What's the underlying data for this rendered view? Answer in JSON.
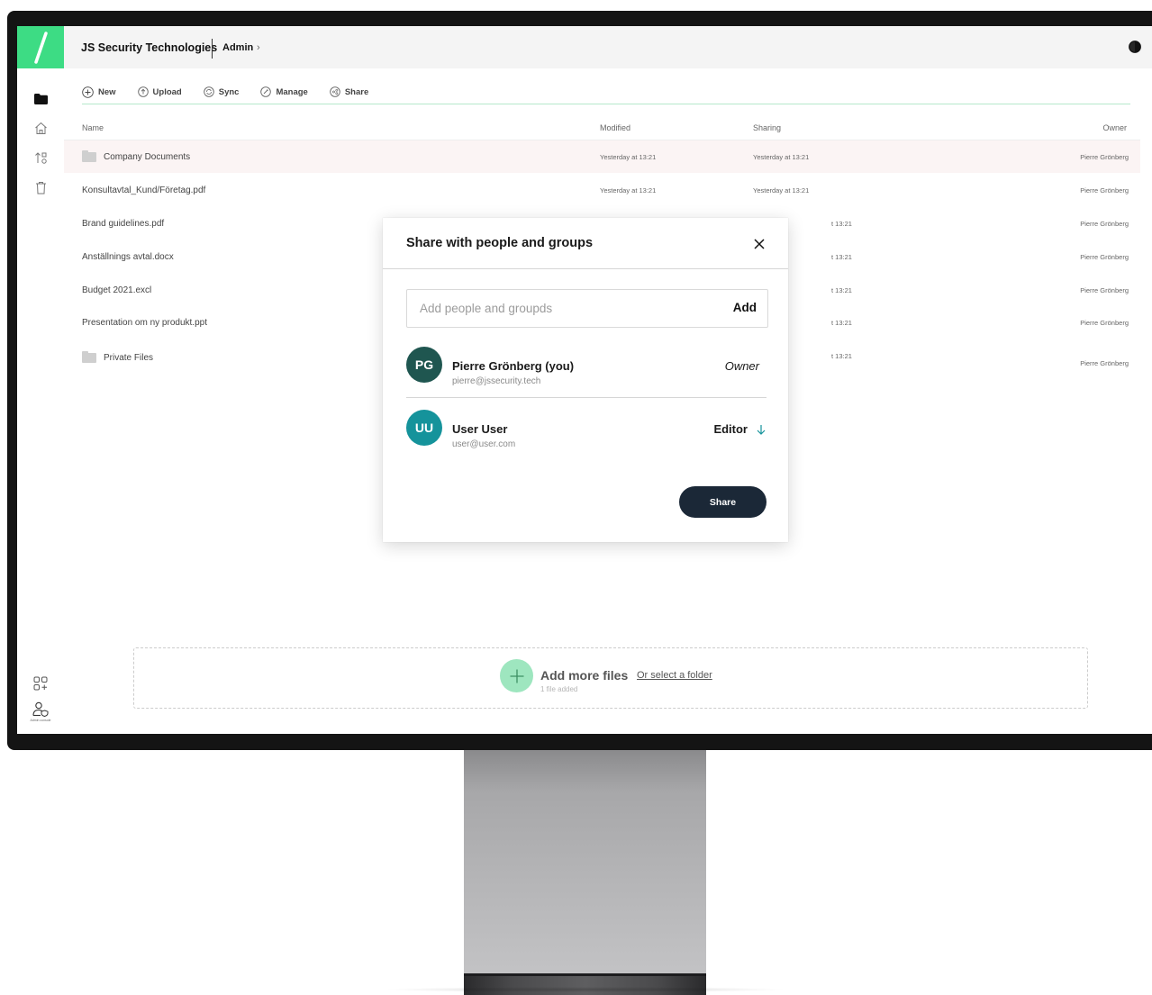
{
  "header": {
    "org_name": "JS Security Technologies",
    "breadcrumb": "Admin",
    "breadcrumb_chevron": "›"
  },
  "toolbar": {
    "new_label": "New",
    "upload_label": "Upload",
    "sync_label": "Sync",
    "manage_label": "Manage",
    "share_label": "Share"
  },
  "table": {
    "columns": {
      "name": "Name",
      "modified": "Modified",
      "sharing": "Sharing",
      "owner": "Owner"
    },
    "rows": [
      {
        "type": "folder",
        "name": "Company Documents",
        "modified": "Yesterday at 13:21",
        "sharing": "Yesterday at 13:21",
        "owner": "Pierre Grönberg"
      },
      {
        "type": "file",
        "name": "Konsultavtal_Kund/Företag.pdf",
        "modified": "Yesterday at 13:21",
        "sharing": "Yesterday at 13:21",
        "owner": "Pierre Grönberg"
      },
      {
        "type": "file",
        "name": "Brand guidelines.pdf",
        "modified": "",
        "sharing": "t 13:21",
        "owner": "Pierre Grönberg"
      },
      {
        "type": "file",
        "name": "Anställnings avtal.docx",
        "modified": "",
        "sharing": "t 13:21",
        "owner": "Pierre Grönberg"
      },
      {
        "type": "file",
        "name": "Budget 2021.excl",
        "modified": "",
        "sharing": "t 13:21",
        "owner": "Pierre Grönberg"
      },
      {
        "type": "file",
        "name": "Presentation om ny produkt.ppt",
        "modified": "",
        "sharing": "t 13:21",
        "owner": "Pierre Grönberg"
      },
      {
        "type": "folder",
        "name": "Private Files",
        "modified": "",
        "sharing": "t 13:21",
        "owner": "Pierre Grönberg"
      }
    ]
  },
  "dropzone": {
    "title": "Add more files",
    "select_folder": "Or select a folder",
    "files_added": "1 file added"
  },
  "rail": {
    "admin_label": "Admin console"
  },
  "modal": {
    "title": "Share with people and groups",
    "input_placeholder": "Add people and groupds",
    "add_label": "Add",
    "people": [
      {
        "initials": "PG",
        "name": "Pierre Grönberg (you)",
        "email": "pierre@jssecurity.tech",
        "role": "Owner",
        "avatar_color": "#1f5650"
      },
      {
        "initials": "UU",
        "name": "User User",
        "email": "user@user.com",
        "role": "Editor",
        "avatar_color": "#15939b"
      }
    ],
    "share_button": "Share"
  },
  "colors": {
    "brand_green": "#3ddc84",
    "share_button_bg": "#1b2837",
    "highlight_row": "#fbf4f4"
  }
}
